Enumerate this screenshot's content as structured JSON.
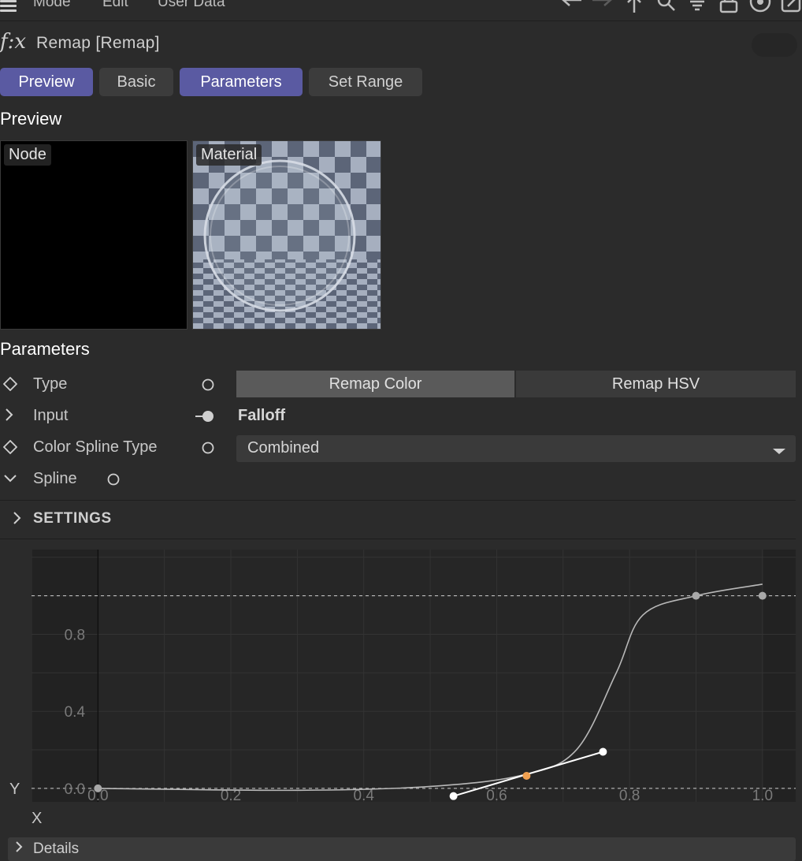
{
  "menu": {
    "items": [
      "Mode",
      "Edit",
      "User Data"
    ]
  },
  "toolbar_icons": [
    "back-arrow-icon",
    "forward-arrow-icon",
    "up-arrow-icon",
    "search-icon",
    "filter-icon",
    "lock-icon",
    "target-icon",
    "external-link-icon"
  ],
  "header": {
    "fx_symbol": "f:x",
    "title": "Remap [Remap]"
  },
  "tabs": [
    {
      "label": "Preview",
      "active": true
    },
    {
      "label": "Basic",
      "active": false
    },
    {
      "label": "Parameters",
      "active": true
    },
    {
      "label": "Set Range",
      "active": false
    }
  ],
  "preview": {
    "title": "Preview",
    "node_label": "Node",
    "material_label": "Material"
  },
  "parameters": {
    "title": "Parameters",
    "type_label": "Type",
    "type_options": [
      "Remap Color",
      "Remap HSV"
    ],
    "type_selected": "Remap Color",
    "input_label": "Input",
    "input_value": "Falloff",
    "color_spline_label": "Color Spline Type",
    "color_spline_value": "Combined",
    "spline_label": "Spline",
    "settings_label": "SETTINGS"
  },
  "colors": {
    "accent_tab": "#5a5aa2",
    "curve": "#b8b8b8",
    "selected_point": "#f0a050",
    "background": "#2b2b2b"
  },
  "chart_data": {
    "type": "line",
    "xlabel": "X",
    "ylabel": "Y",
    "xlim": [
      -0.1,
      1.05
    ],
    "ylim": [
      -0.07,
      1.24
    ],
    "x_ticks": [
      "0.0",
      "0.2",
      "0.4",
      "0.6",
      "0.8",
      "1.0"
    ],
    "y_ticks": [
      "0.0",
      "0.4",
      "0.8"
    ],
    "grid": true,
    "curve_points": [
      {
        "x": 0.0,
        "y": 0.0
      },
      {
        "x": 0.3,
        "y": -0.01
      },
      {
        "x": 0.5,
        "y": 0.01
      },
      {
        "x": 0.64,
        "y": 0.07
      },
      {
        "x": 0.72,
        "y": 0.2
      },
      {
        "x": 0.78,
        "y": 0.6
      },
      {
        "x": 0.82,
        "y": 0.9
      },
      {
        "x": 0.9,
        "y": 1.0
      },
      {
        "x": 1.0,
        "y": 1.06
      }
    ],
    "knots": [
      {
        "x": 0.0,
        "y": 0.0,
        "selected": false
      },
      {
        "x": 0.645,
        "y": 0.065,
        "selected": true
      },
      {
        "x": 0.9,
        "y": 1.0,
        "selected": false
      },
      {
        "x": 1.0,
        "y": 1.0,
        "selected": false
      }
    ],
    "tangent_handles": [
      {
        "x": 0.535,
        "y": -0.04
      },
      {
        "x": 0.76,
        "y": 0.19
      }
    ],
    "reference_lines_y": [
      0.0,
      1.0
    ]
  },
  "footer": {
    "details_label": "Details"
  }
}
